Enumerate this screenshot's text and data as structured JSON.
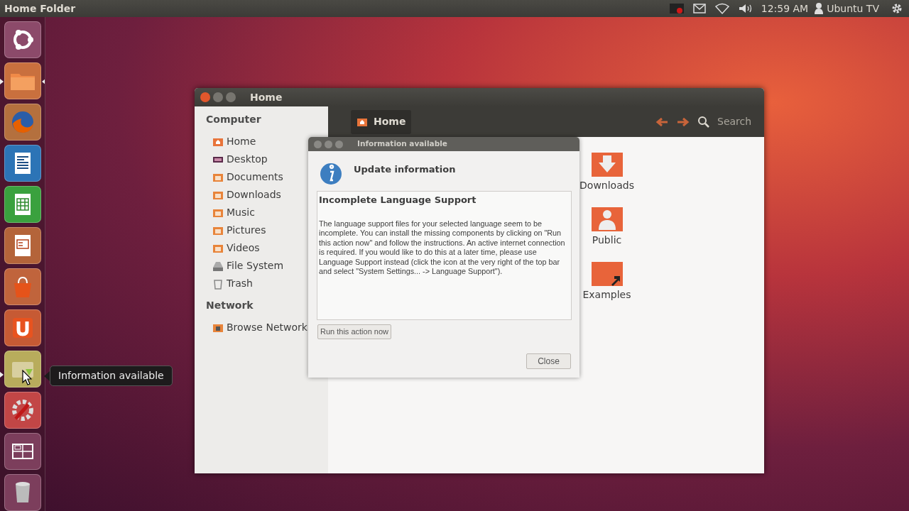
{
  "top_panel": {
    "title": "Home Folder",
    "time": "12:59 AM",
    "user": "Ubuntu TV"
  },
  "launcher": [
    {
      "kind": "ubuntu",
      "running": false,
      "focused": false
    },
    {
      "kind": "folder",
      "running": true,
      "focused": true
    },
    {
      "kind": "firefox",
      "running": false,
      "focused": false
    },
    {
      "kind": "writer",
      "running": false,
      "focused": false
    },
    {
      "kind": "calc",
      "running": false,
      "focused": false
    },
    {
      "kind": "impress",
      "running": false,
      "focused": false
    },
    {
      "kind": "store",
      "running": false,
      "focused": false
    },
    {
      "kind": "cloud",
      "running": false,
      "focused": false
    },
    {
      "kind": "update",
      "running": true,
      "focused": false
    },
    {
      "kind": "settings",
      "running": false,
      "focused": false
    },
    {
      "kind": "workspaces",
      "running": false,
      "focused": false
    },
    {
      "kind": "trash",
      "running": false,
      "focused": false
    }
  ],
  "tooltip": "Information available",
  "window": {
    "title": "Home",
    "sidebar": [
      {
        "heading": "Computer",
        "items": [
          {
            "label": "Home",
            "kind": "home"
          },
          {
            "label": "Desktop",
            "kind": "desktop"
          },
          {
            "label": "Documents",
            "kind": "folder"
          },
          {
            "label": "Downloads",
            "kind": "folder"
          },
          {
            "label": "Music",
            "kind": "folder"
          },
          {
            "label": "Pictures",
            "kind": "folder"
          },
          {
            "label": "Videos",
            "kind": "folder"
          },
          {
            "label": "File System",
            "kind": "drive"
          },
          {
            "label": "Trash",
            "kind": "trash"
          }
        ]
      },
      {
        "heading": "Network",
        "items": [
          {
            "label": "Browse Network",
            "kind": "network"
          }
        ]
      }
    ],
    "breadcrumb": "Home",
    "search": {
      "placeholder": "Search"
    },
    "files": [
      {
        "label": "Downloads",
        "kind": "downloads"
      },
      {
        "label": "Public",
        "kind": "public"
      },
      {
        "label": "Examples",
        "kind": "examples"
      }
    ]
  },
  "dialog": {
    "title": "Information available",
    "heading": "Update information",
    "panel_heading": "Incomplete Language Support",
    "body": "The language support files for your selected language seem to be incomplete. You can install the missing components by clicking on \"Run this action now\" and follow the instructions. An active internet connection is required. If you would like to do this at a later time, please use Language Support instead (click the icon at the very right of the top bar and select \"System Settings... -> Language Support\").",
    "action_button": "Run this action now",
    "close_button": "Close"
  }
}
